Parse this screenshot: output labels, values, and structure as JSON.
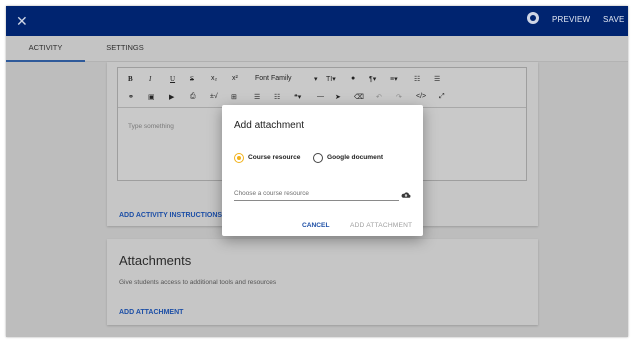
{
  "appbar": {
    "close_glyph": "✕",
    "preview_label": "PREVIEW",
    "save_label": "SAVE",
    "colors": {
      "background": "#002470",
      "text": "#e6ebf5"
    }
  },
  "tabs": [
    {
      "label": "ACTIVITY",
      "active": true
    },
    {
      "label": "SETTINGS",
      "active": false
    }
  ],
  "editor": {
    "toolbar_row1": [
      "B",
      "I",
      "U",
      "S",
      "x₂",
      "x²",
      "Font Family",
      "▾",
      "TI▾",
      "●",
      "¶▾",
      "≡▾",
      "☷",
      "☰"
    ],
    "toolbar_row2": [
      "⚭",
      "▣",
      "▶",
      "⎙",
      "±√",
      "⊞",
      "☰",
      "☷",
      "❝▾",
      "—",
      "➤",
      "⌫",
      "↶",
      "↷",
      "</>",
      "⤢"
    ],
    "font_family_label": "Font Family",
    "placeholder": "Type something"
  },
  "instructions_link": "ADD ACTIVITY INSTRUCTIONS",
  "attachments": {
    "heading": "Attachments",
    "description": "Give students access to additional tools and resources",
    "add_link": "ADD ATTACHMENT"
  },
  "dialog": {
    "title": "Add attachment",
    "options": [
      {
        "label": "Course resource",
        "selected": true
      },
      {
        "label": "Google document",
        "selected": false
      }
    ],
    "field_placeholder": "Choose a course resource",
    "cancel_label": "CANCEL",
    "add_label": "ADD ATTACHMENT",
    "colors": {
      "accent": "#f2b21b",
      "link": "#1d4fa6"
    }
  }
}
